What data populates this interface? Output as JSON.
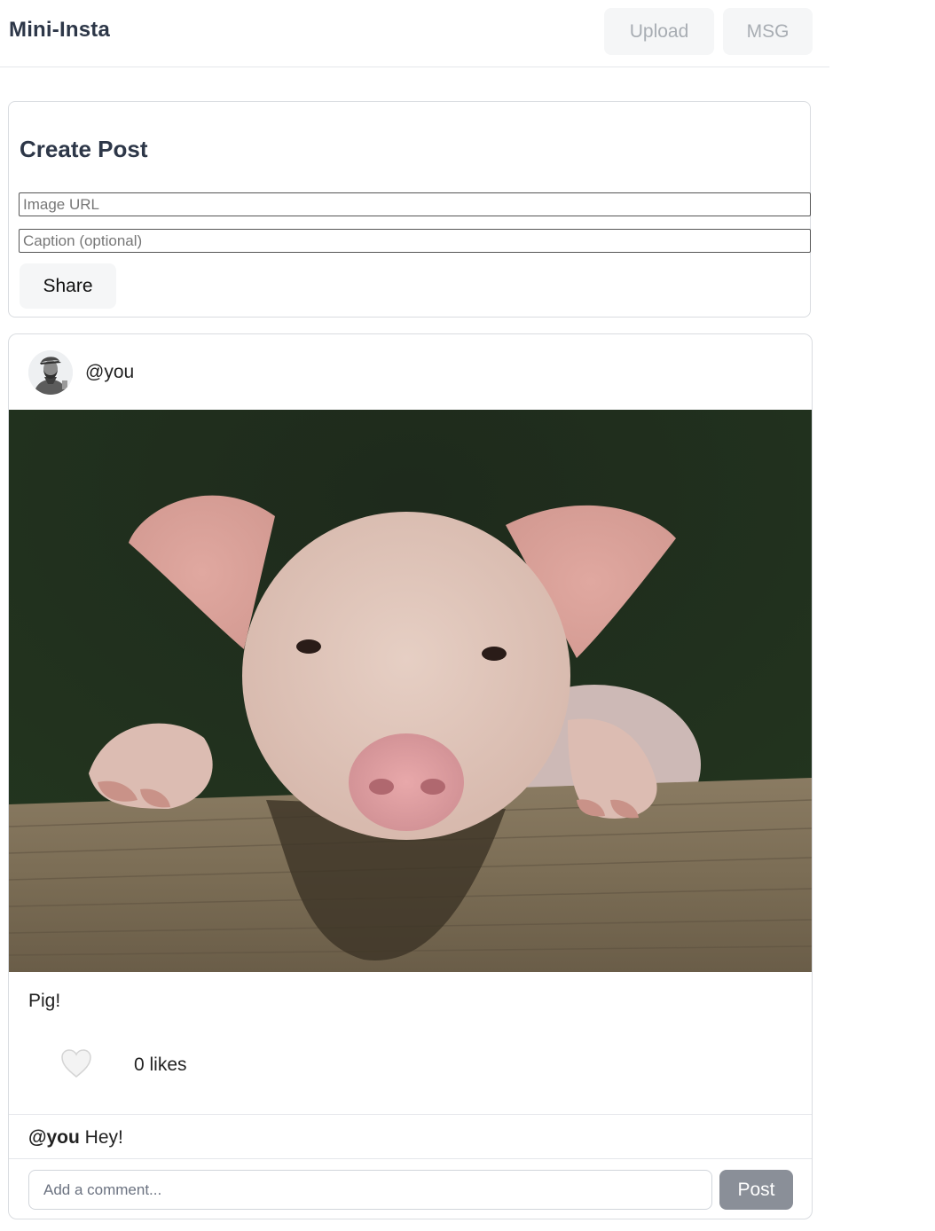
{
  "header": {
    "brand": "Mini-Insta",
    "upload_label": "Upload",
    "msg_label": "MSG"
  },
  "create_post": {
    "title": "Create Post",
    "image_url_placeholder": "Image URL",
    "caption_placeholder": "Caption (optional)",
    "share_label": "Share"
  },
  "post": {
    "author": "@you",
    "caption": "Pig!",
    "likes_text": "0 likes",
    "like_icon": "heart-icon",
    "comments": [
      {
        "user": "@you",
        "text": "Hey!"
      }
    ],
    "comment_placeholder": "Add a comment...",
    "post_label": "Post"
  },
  "colors": {
    "post_button_bg": "#8a8f98",
    "top_button_bg": "#f5f6f7",
    "top_button_text": "#a8adb3"
  }
}
